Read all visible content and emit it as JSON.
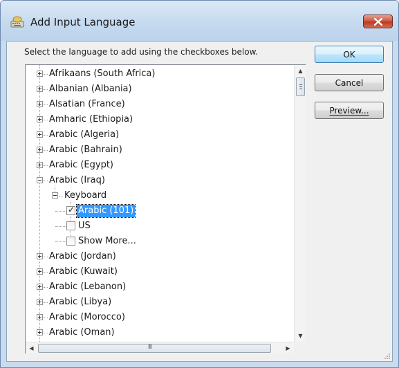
{
  "window": {
    "title": "Add Input Language",
    "close_icon": "close-icon"
  },
  "instruction": "Select the language to add using the checkboxes below.",
  "buttons": {
    "ok": "OK",
    "cancel": "Cancel",
    "preview": "Preview..."
  },
  "tree": {
    "items": [
      {
        "label": "Afrikaans (South Africa)",
        "expanded": false
      },
      {
        "label": "Albanian (Albania)",
        "expanded": false
      },
      {
        "label": "Alsatian (France)",
        "expanded": false
      },
      {
        "label": "Amharic (Ethiopia)",
        "expanded": false
      },
      {
        "label": "Arabic (Algeria)",
        "expanded": false
      },
      {
        "label": "Arabic (Bahrain)",
        "expanded": false
      },
      {
        "label": "Arabic (Egypt)",
        "expanded": false
      },
      {
        "label": "Arabic (Iraq)",
        "expanded": true
      },
      {
        "label": "Keyboard",
        "expanded": true
      },
      {
        "label": "Arabic (101)",
        "checked": true,
        "selected": true
      },
      {
        "label": "US",
        "checked": false
      },
      {
        "label": "Show More...",
        "checked": false
      },
      {
        "label": "Arabic (Jordan)",
        "expanded": false
      },
      {
        "label": "Arabic (Kuwait)",
        "expanded": false
      },
      {
        "label": "Arabic (Lebanon)",
        "expanded": false
      },
      {
        "label": "Arabic (Libya)",
        "expanded": false
      },
      {
        "label": "Arabic (Morocco)",
        "expanded": false
      },
      {
        "label": "Arabic (Oman)",
        "expanded": false
      }
    ]
  },
  "scrollbars": {
    "hscroll_grip": "III"
  }
}
